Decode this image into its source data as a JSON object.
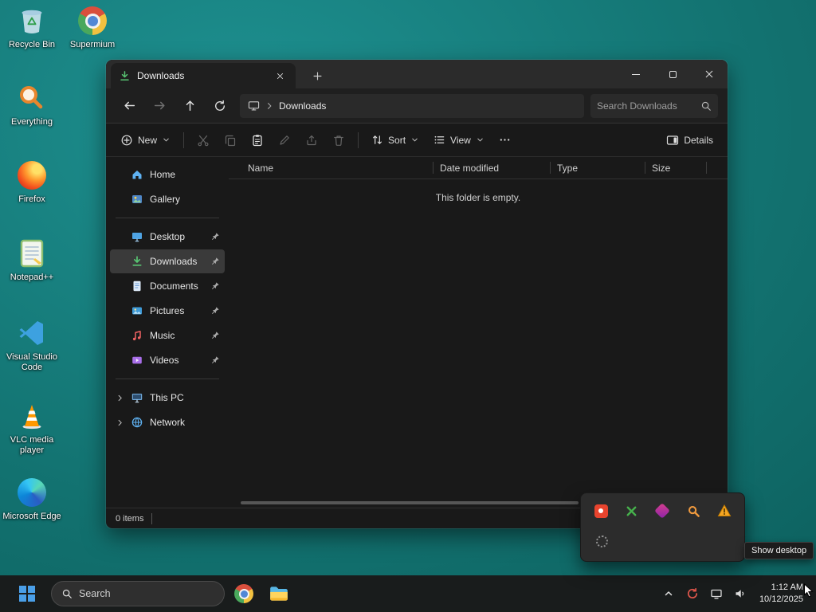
{
  "colors": {
    "desktop_teal": "#12716f",
    "taskbar_bg": "#1a1a1a",
    "window_bg": "#191919",
    "selection_gray": "#3a3a3a",
    "downloads_green": "#58c472"
  },
  "desktop": {
    "icons": [
      {
        "label": "Recycle Bin",
        "icon": "recycle-bin-icon"
      },
      {
        "label": "Supermium",
        "icon": "supermium-icon"
      },
      {
        "label": "Everything",
        "icon": "everything-icon"
      },
      {
        "label": "Firefox",
        "icon": "firefox-icon"
      },
      {
        "label": "Notepad++",
        "icon": "notepad-plus-plus-icon"
      },
      {
        "label": "Visual Studio Code",
        "icon": "vscode-icon"
      },
      {
        "label": "VLC media player",
        "icon": "vlc-icon"
      },
      {
        "label": "Microsoft Edge",
        "icon": "edge-icon"
      }
    ]
  },
  "explorer": {
    "tab_title": "Downloads",
    "address": {
      "path": "Downloads"
    },
    "search_placeholder": "Search Downloads",
    "toolbar": {
      "new_label": "New",
      "sort_label": "Sort",
      "view_label": "View",
      "details_label": "Details",
      "icon_buttons": [
        "cut-icon",
        "copy-icon",
        "paste-icon",
        "rename-icon",
        "share-icon",
        "delete-icon",
        "more-icon"
      ]
    },
    "sidebar": {
      "items_top": [
        {
          "label": "Home",
          "icon": "home-icon"
        },
        {
          "label": "Gallery",
          "icon": "gallery-icon"
        }
      ],
      "items_pinned": [
        {
          "label": "Desktop",
          "icon": "desktop-monitor-icon",
          "pinned": true,
          "selected": false
        },
        {
          "label": "Downloads",
          "icon": "downloads-icon",
          "pinned": true,
          "selected": true
        },
        {
          "label": "Documents",
          "icon": "documents-icon",
          "pinned": true,
          "selected": false
        },
        {
          "label": "Pictures",
          "icon": "pictures-icon",
          "pinned": true,
          "selected": false
        },
        {
          "label": "Music",
          "icon": "music-icon",
          "pinned": true,
          "selected": false
        },
        {
          "label": "Videos",
          "icon": "videos-icon",
          "pinned": true,
          "selected": false
        }
      ],
      "items_tree": [
        {
          "label": "This PC",
          "icon": "this-pc-icon"
        },
        {
          "label": "Network",
          "icon": "network-icon"
        }
      ]
    },
    "columns": [
      "Name",
      "Date modified",
      "Type",
      "Size"
    ],
    "empty_message": "This folder is empty.",
    "status_bar": {
      "items_count": "0 items"
    }
  },
  "tray_flyout": {
    "icons": [
      "red-app-icon",
      "green-cut-icon",
      "purple-app-icon",
      "orange-search-icon",
      "warning-icon",
      "spinner-icon"
    ]
  },
  "tooltip": {
    "show_desktop": "Show desktop"
  },
  "taskbar": {
    "search_placeholder": "Search",
    "clock": {
      "time": "1:12 AM",
      "date": "10/12/2025"
    }
  }
}
